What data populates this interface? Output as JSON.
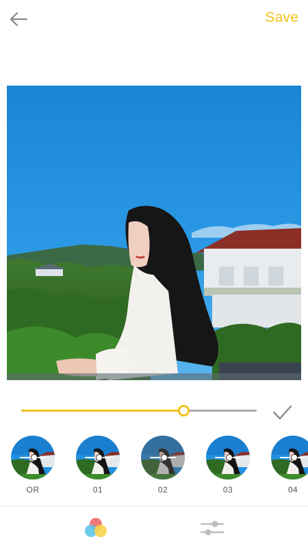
{
  "header": {
    "back_icon": "arrow-left-icon",
    "save_label": "Save",
    "accent_color": "#F2C21B"
  },
  "editor": {
    "photo_description_icon": "photo-preview",
    "intensity_fraction": 0.69,
    "confirm_icon": "checkmark-icon"
  },
  "filters": {
    "items": [
      {
        "label": "OR",
        "selected": false
      },
      {
        "label": "01",
        "selected": false
      },
      {
        "label": "02",
        "selected": true
      },
      {
        "label": "03",
        "selected": false
      },
      {
        "label": "04",
        "selected": false
      }
    ]
  },
  "bottom_tabs": {
    "items": [
      {
        "icon": "color-filter-icon",
        "active": true
      },
      {
        "icon": "adjust-sliders-icon",
        "active": false
      }
    ]
  }
}
